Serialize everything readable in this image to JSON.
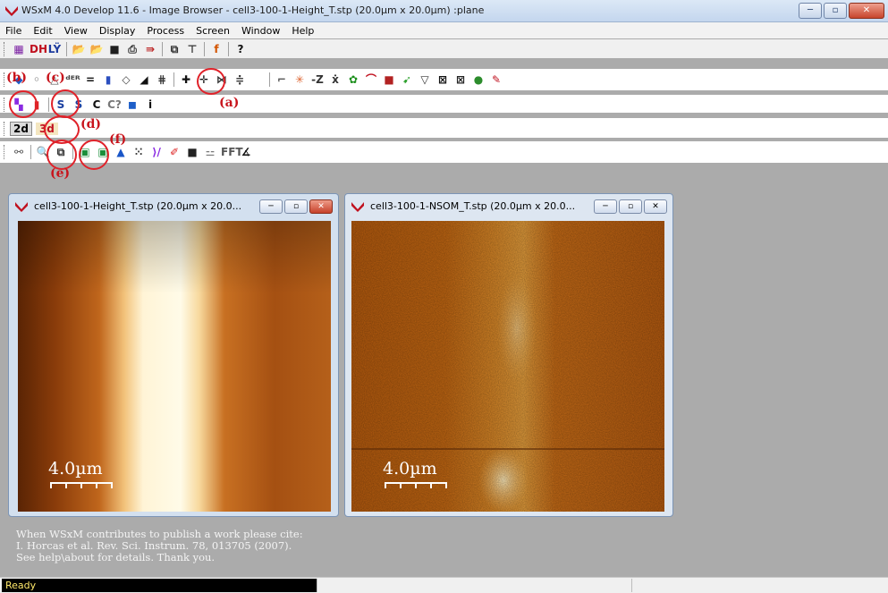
{
  "app": {
    "title": "WSxM 4.0 Develop 11.6 - Image Browser - cell3-100-1-Height_T.stp (20.0µm x 20.0µm) :plane",
    "window_buttons": [
      "─",
      "▫",
      "✕"
    ]
  },
  "menu": [
    "File",
    "Edit",
    "View",
    "Display",
    "Process",
    "Screen",
    "Window",
    "Help"
  ],
  "toolbar1": {
    "items": [
      {
        "name": "grid-icon",
        "glyph": "▦",
        "color": "#7a1fa2"
      },
      {
        "name": "dh-icon",
        "glyph": "DH",
        "color": "#c0101e"
      },
      {
        "name": "ly-icon",
        "glyph": "LŸ",
        "color": "#1e3c9e"
      },
      {
        "name": "open-folder-icon",
        "glyph": "📂",
        "color": "#b8860b"
      },
      {
        "name": "open-folder2-icon",
        "glyph": "📂",
        "color": "#b8860b"
      },
      {
        "name": "save-icon",
        "glyph": "■",
        "color": "#1f1f1f"
      },
      {
        "name": "print-icon",
        "glyph": "⎙",
        "color": "#333"
      },
      {
        "name": "info-icon",
        "glyph": "⇛",
        "color": "#b22"
      },
      {
        "name": "copy-icon",
        "glyph": "⧉",
        "color": "#333"
      },
      {
        "name": "network-icon",
        "glyph": "⊤",
        "color": "#333"
      },
      {
        "name": "function-icon",
        "glyph": "f",
        "color": "#d35400"
      },
      {
        "name": "help-icon",
        "glyph": "?",
        "color": "#111"
      }
    ]
  },
  "toolbar2": {
    "items": [
      {
        "name": "map-icon",
        "glyph": "◆",
        "color": "#1f5ec8"
      },
      {
        "name": "filter-icon",
        "glyph": "◦",
        "color": "#666"
      },
      {
        "name": "triangle-icon",
        "glyph": "△",
        "color": "#555"
      },
      {
        "name": "deriv-icon",
        "glyph": "ᵈᴱᴿ",
        "color": "#444"
      },
      {
        "name": "equal-icon",
        "glyph": "=",
        "color": "#111"
      },
      {
        "name": "palette-icon",
        "glyph": "▮",
        "color": "#2b4fbf"
      },
      {
        "name": "diamond-icon",
        "glyph": "◇",
        "color": "#444"
      },
      {
        "name": "plane-icon",
        "glyph": "◢",
        "color": "#111"
      },
      {
        "name": "grid2-icon",
        "glyph": "⋕",
        "color": "#333"
      },
      {
        "name": "cross-icon",
        "glyph": "✚",
        "color": "#111"
      },
      {
        "name": "crossxyz-icon",
        "glyph": "✛",
        "color": "#111"
      },
      {
        "name": "mirror-icon",
        "glyph": "⋈",
        "color": "#333"
      },
      {
        "name": "flip-icon",
        "glyph": "≑",
        "color": "#333"
      },
      {
        "name": "blank-icon",
        "glyph": "",
        "color": "#999"
      },
      {
        "name": "profile-icon",
        "glyph": "⌐",
        "color": "#555"
      },
      {
        "name": "star-icon",
        "glyph": "✳",
        "color": "#d63"
      },
      {
        "name": "z-icon",
        "glyph": "-Z",
        "color": "#333"
      },
      {
        "name": "xy-icon",
        "glyph": "ẋ",
        "color": "#333"
      },
      {
        "name": "tree-icon",
        "glyph": "✿",
        "color": "#1a8e1a"
      },
      {
        "name": "arc-icon",
        "glyph": "⌒",
        "color": "#c0101e"
      },
      {
        "name": "square-icon",
        "glyph": "■",
        "color": "#b22222"
      },
      {
        "name": "arrow-icon",
        "glyph": "➹",
        "color": "#2aa02a"
      },
      {
        "name": "funnel-icon",
        "glyph": "▽",
        "color": "#333"
      },
      {
        "name": "x-box-icon",
        "glyph": "⊠",
        "color": "#111"
      },
      {
        "name": "x-box2-icon",
        "glyph": "⊠",
        "color": "#222"
      },
      {
        "name": "green-disc-icon",
        "glyph": "●",
        "color": "#2c8c2c"
      },
      {
        "name": "brush-icon",
        "glyph": "✎",
        "color": "#c0101e"
      }
    ]
  },
  "toolbar3": {
    "items": [
      {
        "name": "flood-icon",
        "glyph": "▚",
        "color": "#8a2be2"
      },
      {
        "name": "color-bars-icon",
        "glyph": "▮",
        "color": "#d22"
      },
      {
        "name": "s-icon",
        "glyph": "S",
        "color": "#1a3fa0"
      },
      {
        "name": "s-underlined-icon",
        "glyph": "S",
        "color": "#1a3fa0"
      },
      {
        "name": "c-icon",
        "glyph": "C",
        "color": "#111"
      },
      {
        "name": "c-question-icon",
        "glyph": "C?",
        "color": "#777"
      },
      {
        "name": "cube-icon",
        "glyph": "◼",
        "color": "#1d5ec8"
      },
      {
        "name": "i-icon",
        "glyph": "i",
        "color": "#111"
      }
    ]
  },
  "toolbar4": {
    "btn2d": "2d",
    "btn3d": "3d"
  },
  "toolbar5": {
    "items": [
      {
        "name": "flow-icon",
        "glyph": "⚯",
        "color": "#555"
      },
      {
        "name": "zoom-icon",
        "glyph": "🔍",
        "color": "#333"
      },
      {
        "name": "frame-icon",
        "glyph": "⧉",
        "color": "#333"
      },
      {
        "name": "green-square-icon",
        "glyph": "▣",
        "color": "#1a8e3a"
      },
      {
        "name": "green-square2-icon",
        "glyph": "▣",
        "color": "#1a8e3a"
      },
      {
        "name": "mountain-icon",
        "glyph": "▲",
        "color": "#1a56c8"
      },
      {
        "name": "dots-icon",
        "glyph": "⁙",
        "color": "#333"
      },
      {
        "name": "curve-icon",
        "glyph": "⟩/",
        "color": "#8a2be2"
      },
      {
        "name": "pen-icon",
        "glyph": "✐",
        "color": "#d22"
      },
      {
        "name": "camera-icon",
        "glyph": "■",
        "color": "#222"
      },
      {
        "name": "bars-icon",
        "glyph": "⚍",
        "color": "#777"
      },
      {
        "name": "fft-icon",
        "glyph": "FFT",
        "color": "#555"
      },
      {
        "name": "angle-icon",
        "glyph": "∡",
        "color": "#111"
      }
    ]
  },
  "annotations": [
    "(a)",
    "(b)",
    "(c)",
    "(d)",
    "(e)",
    "(f)"
  ],
  "windows": [
    {
      "title": "cell3-100-1-Height_T.stp (20.0µm x 20.0...",
      "scale_label": "4.0µm",
      "buttons": [
        "─",
        "▫",
        "✕"
      ]
    },
    {
      "title": "cell3-100-1-NSOM_T.stp (20.0µm x 20.0...",
      "scale_label": "4.0µm",
      "buttons": [
        "─",
        "▫",
        "✕"
      ]
    }
  ],
  "citation": [
    "When WSxM contributes to publish a work please cite:",
    "I. Horcas et al. Rev. Sci. Instrum. 78, 013705 (2007).",
    "See help\\about for details. Thank you."
  ],
  "status": {
    "text": "Ready"
  }
}
